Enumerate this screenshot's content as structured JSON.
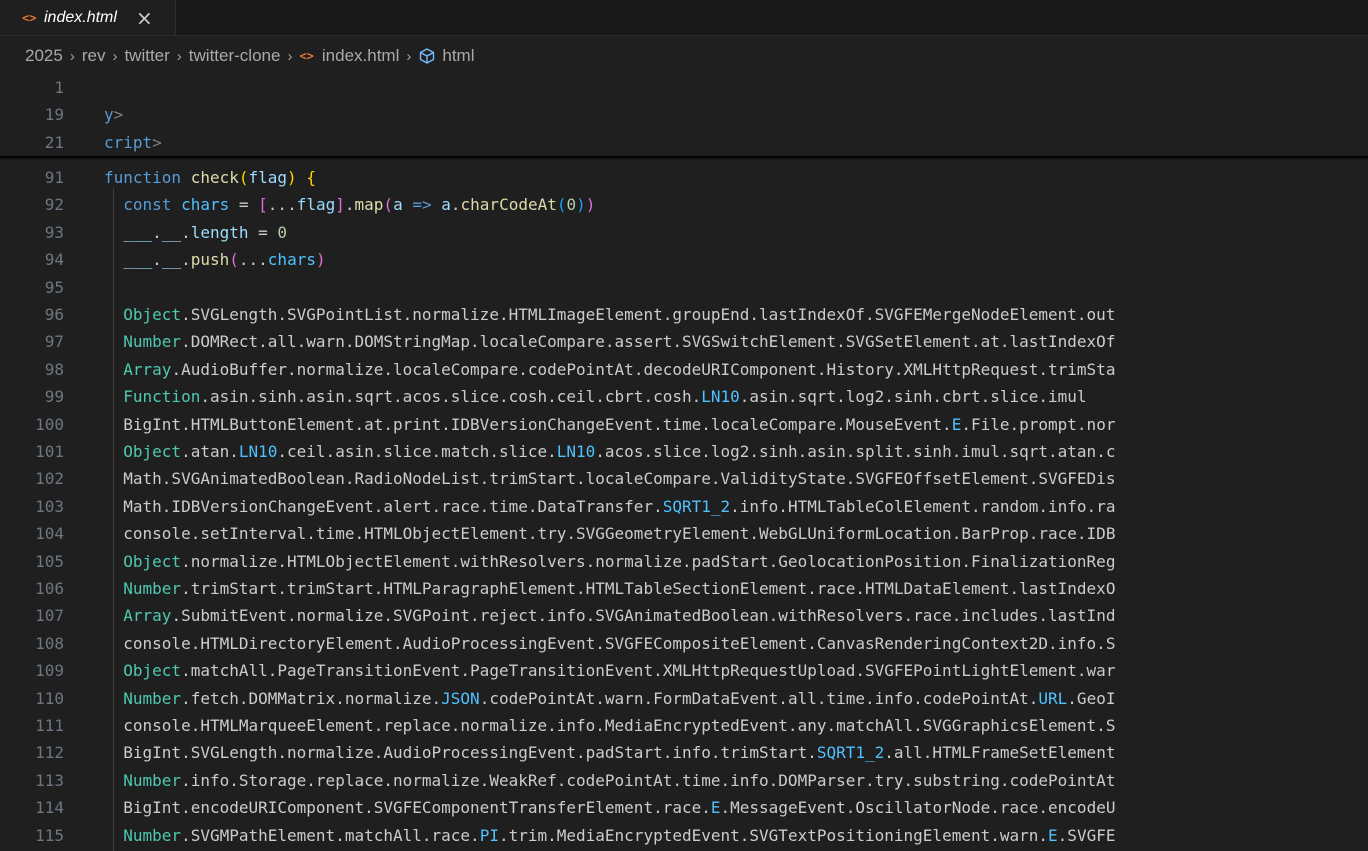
{
  "tab": {
    "icon": "<>",
    "label": "index.html",
    "close": "×"
  },
  "breadcrumb": [
    "2025",
    "rev",
    "twitter",
    "twitter-clone",
    "index.html",
    "html"
  ],
  "sticky": [
    {
      "ln": "1",
      "tokens": []
    },
    {
      "ln": "19",
      "tokens": [
        [
          "tagname",
          "y"
        ],
        [
          "tag",
          ">"
        ]
      ]
    },
    {
      "ln": "21",
      "tokens": [
        [
          "tagname",
          "cript"
        ],
        [
          "tag",
          ">"
        ]
      ]
    }
  ],
  "lines": [
    {
      "ln": "91",
      "tokens": [
        [
          "kw",
          "function"
        ],
        [
          "p",
          " "
        ],
        [
          "fn",
          "check"
        ],
        [
          "br1",
          "("
        ],
        [
          "var",
          "flag"
        ],
        [
          "br1",
          ")"
        ],
        [
          "p",
          " "
        ],
        [
          "br1",
          "{"
        ]
      ]
    },
    {
      "ln": "92",
      "tokens": [
        [
          "p",
          "  "
        ],
        [
          "kw",
          "const"
        ],
        [
          "p",
          " "
        ],
        [
          "const",
          "chars"
        ],
        [
          "p",
          " = "
        ],
        [
          "br2",
          "["
        ],
        [
          "p",
          "..."
        ],
        [
          "var",
          "flag"
        ],
        [
          "br2",
          "]"
        ],
        [
          "p",
          "."
        ],
        [
          "fn",
          "map"
        ],
        [
          "br2",
          "("
        ],
        [
          "var",
          "a"
        ],
        [
          "p",
          " "
        ],
        [
          "kw",
          "=>"
        ],
        [
          "p",
          " "
        ],
        [
          "var",
          "a"
        ],
        [
          "p",
          "."
        ],
        [
          "fn",
          "charCodeAt"
        ],
        [
          "br3",
          "("
        ],
        [
          "num",
          "0"
        ],
        [
          "br3",
          ")"
        ],
        [
          "br2",
          ")"
        ]
      ]
    },
    {
      "ln": "93",
      "tokens": [
        [
          "p",
          "  "
        ],
        [
          "var",
          "___"
        ],
        [
          "p",
          "."
        ],
        [
          "var",
          "__"
        ],
        [
          "p",
          "."
        ],
        [
          "var",
          "length"
        ],
        [
          "p",
          " = "
        ],
        [
          "num",
          "0"
        ]
      ]
    },
    {
      "ln": "94",
      "tokens": [
        [
          "p",
          "  "
        ],
        [
          "var",
          "___"
        ],
        [
          "p",
          "."
        ],
        [
          "var",
          "__"
        ],
        [
          "p",
          "."
        ],
        [
          "fn",
          "push"
        ],
        [
          "br2",
          "("
        ],
        [
          "p",
          "..."
        ],
        [
          "const",
          "chars"
        ],
        [
          "br2",
          ")"
        ]
      ]
    },
    {
      "ln": "95",
      "tokens": []
    },
    {
      "ln": "96",
      "tokens": [
        [
          "p",
          "  "
        ],
        [
          "cls",
          "Object"
        ],
        [
          "p",
          ".SVGLength.SVGPointList.normalize.HTMLImageElement.groupEnd.lastIndexOf.SVGFEMergeNodeElement.out"
        ]
      ]
    },
    {
      "ln": "97",
      "tokens": [
        [
          "p",
          "  "
        ],
        [
          "cls",
          "Number"
        ],
        [
          "p",
          ".DOMRect.all.warn.DOMStringMap.localeCompare.assert.SVGSwitchElement.SVGSetElement.at.lastIndexOf"
        ]
      ]
    },
    {
      "ln": "98",
      "tokens": [
        [
          "p",
          "  "
        ],
        [
          "cls",
          "Array"
        ],
        [
          "p",
          ".AudioBuffer.normalize.localeCompare.codePointAt.decodeURIComponent.History.XMLHttpRequest.trimSta"
        ]
      ]
    },
    {
      "ln": "99",
      "tokens": [
        [
          "p",
          "  "
        ],
        [
          "cls",
          "Function"
        ],
        [
          "p",
          ".asin.sinh.asin.sqrt.acos.slice.cosh.ceil.cbrt.cosh."
        ],
        [
          "const",
          "LN10"
        ],
        [
          "p",
          ".asin.sqrt.log2.sinh.cbrt.slice.imul"
        ]
      ]
    },
    {
      "ln": "100",
      "tokens": [
        [
          "p",
          "  BigInt.HTMLButtonElement.at.print.IDBVersionChangeEvent.time.localeCompare.MouseEvent."
        ],
        [
          "const",
          "E"
        ],
        [
          "p",
          ".File.prompt.nor"
        ]
      ]
    },
    {
      "ln": "101",
      "tokens": [
        [
          "p",
          "  "
        ],
        [
          "cls",
          "Object"
        ],
        [
          "p",
          ".atan."
        ],
        [
          "const",
          "LN10"
        ],
        [
          "p",
          ".ceil.asin.slice.match.slice."
        ],
        [
          "const",
          "LN10"
        ],
        [
          "p",
          ".acos.slice.log2.sinh.asin.split.sinh.imul.sqrt.atan.c"
        ]
      ]
    },
    {
      "ln": "102",
      "tokens": [
        [
          "p",
          "  Math.SVGAnimatedBoolean.RadioNodeList.trimStart.localeCompare.ValidityState.SVGFEOffsetElement.SVGFEDis"
        ]
      ]
    },
    {
      "ln": "103",
      "tokens": [
        [
          "p",
          "  Math.IDBVersionChangeEvent.alert.race.time.DataTransfer."
        ],
        [
          "const",
          "SQRT1_2"
        ],
        [
          "p",
          ".info.HTMLTableColElement.random.info.ra"
        ]
      ]
    },
    {
      "ln": "104",
      "tokens": [
        [
          "p",
          "  console.setInterval.time.HTMLObjectElement.try.SVGGeometryElement.WebGLUniformLocation.BarProp.race.IDB"
        ]
      ]
    },
    {
      "ln": "105",
      "tokens": [
        [
          "p",
          "  "
        ],
        [
          "cls",
          "Object"
        ],
        [
          "p",
          ".normalize.HTMLObjectElement.withResolvers.normalize.padStart.GeolocationPosition.FinalizationReg"
        ]
      ]
    },
    {
      "ln": "106",
      "tokens": [
        [
          "p",
          "  "
        ],
        [
          "cls",
          "Number"
        ],
        [
          "p",
          ".trimStart.trimStart.HTMLParagraphElement.HTMLTableSectionElement.race.HTMLDataElement.lastIndexO"
        ]
      ]
    },
    {
      "ln": "107",
      "tokens": [
        [
          "p",
          "  "
        ],
        [
          "cls",
          "Array"
        ],
        [
          "p",
          ".SubmitEvent.normalize.SVGPoint.reject.info.SVGAnimatedBoolean.withResolvers.race.includes.lastInd"
        ]
      ]
    },
    {
      "ln": "108",
      "tokens": [
        [
          "p",
          "  console.HTMLDirectoryElement.AudioProcessingEvent.SVGFECompositeElement.CanvasRenderingContext2D.info.S"
        ]
      ]
    },
    {
      "ln": "109",
      "tokens": [
        [
          "p",
          "  "
        ],
        [
          "cls",
          "Object"
        ],
        [
          "p",
          ".matchAll.PageTransitionEvent.PageTransitionEvent.XMLHttpRequestUpload.SVGFEPointLightElement.war"
        ]
      ]
    },
    {
      "ln": "110",
      "tokens": [
        [
          "p",
          "  "
        ],
        [
          "cls",
          "Number"
        ],
        [
          "p",
          ".fetch.DOMMatrix.normalize."
        ],
        [
          "const",
          "JSON"
        ],
        [
          "p",
          ".codePointAt.warn.FormDataEvent.all.time.info.codePointAt."
        ],
        [
          "const",
          "URL"
        ],
        [
          "p",
          ".GeoI"
        ]
      ]
    },
    {
      "ln": "111",
      "tokens": [
        [
          "p",
          "  console.HTMLMarqueeElement.replace.normalize.info.MediaEncryptedEvent.any.matchAll.SVGGraphicsElement.S"
        ]
      ]
    },
    {
      "ln": "112",
      "tokens": [
        [
          "p",
          "  BigInt.SVGLength.normalize.AudioProcessingEvent.padStart.info.trimStart."
        ],
        [
          "const",
          "SQRT1_2"
        ],
        [
          "p",
          ".all.HTMLFrameSetElement"
        ]
      ]
    },
    {
      "ln": "113",
      "tokens": [
        [
          "p",
          "  "
        ],
        [
          "cls",
          "Number"
        ],
        [
          "p",
          ".info.Storage.replace.normalize.WeakRef.codePointAt.time.info.DOMParser.try.substring.codePointAt"
        ]
      ]
    },
    {
      "ln": "114",
      "tokens": [
        [
          "p",
          "  BigInt.encodeURIComponent.SVGFEComponentTransferElement.race."
        ],
        [
          "const",
          "E"
        ],
        [
          "p",
          ".MessageEvent.OscillatorNode.race.encodeU"
        ]
      ]
    },
    {
      "ln": "115",
      "tokens": [
        [
          "p",
          "  "
        ],
        [
          "cls",
          "Number"
        ],
        [
          "p",
          ".SVGMPathElement.matchAll.race."
        ],
        [
          "const",
          "PI"
        ],
        [
          "p",
          ".trim.MediaEncryptedEvent.SVGTextPositioningElement.warn."
        ],
        [
          "const",
          "E"
        ],
        [
          "p",
          ".SVGFE"
        ]
      ]
    }
  ]
}
